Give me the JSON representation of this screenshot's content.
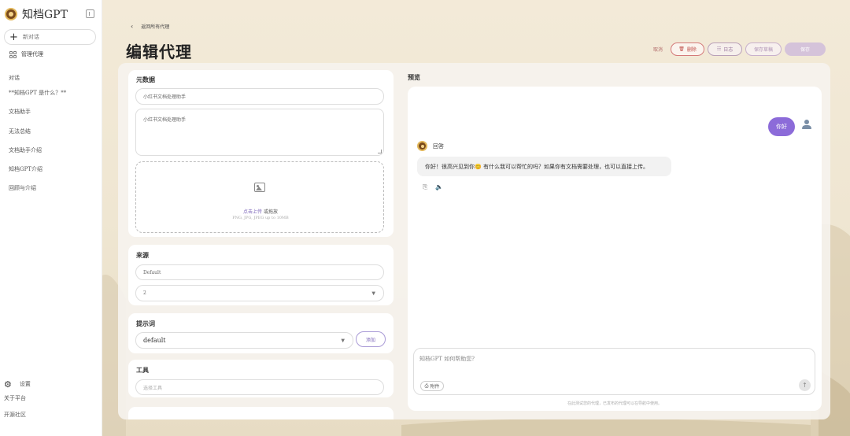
{
  "app": {
    "name": "知档GPT"
  },
  "sidebar": {
    "new_chat": "新对话",
    "manage_agents": "管理代理",
    "section": "对话",
    "conversations": [
      "**知档GPT 是什么？**",
      "文档助手",
      "无法总结",
      "文档助手介绍",
      "知档GPT介绍",
      "回顾与介绍"
    ],
    "settings": "设置",
    "about": "关于平台",
    "community": "开源社区"
  },
  "header": {
    "back_label": "返回所有代理",
    "title": "编辑代理",
    "actions": {
      "cancel": "取消",
      "delete": "删除",
      "logs": "日志",
      "duplicate": "保存草稿",
      "save": "保存"
    }
  },
  "form": {
    "metadata": {
      "title": "元数据",
      "name_value": "小红书文档处理助手",
      "description_value": "小红书文档处理助手",
      "upload_link": "点击上传",
      "upload_or": "或拖放",
      "upload_hint": "PNG, JPG, JPEG up to 10MB"
    },
    "source": {
      "title": "来源",
      "type_value": "Default",
      "select_value": "2"
    },
    "prompt": {
      "title": "提示词",
      "select_value": "default",
      "add_label": "添加"
    },
    "tools": {
      "title": "工具",
      "placeholder": "选择工具"
    }
  },
  "preview": {
    "title": "预览",
    "user_message": "你好",
    "bot_name": "回答",
    "bot_message": "你好！很高兴见到你😊 有什么我可以帮忙的吗？如果你有文档需要处理，也可以直接上传。",
    "input_placeholder": "知档GPT 如何帮助您?",
    "attach_label": "附件",
    "disclaimer": "在此测试您的代理，已发布的代理可以在导航中使用。"
  },
  "colors": {
    "accent": "#8c6bd9",
    "danger": "#c0504a",
    "background": "#f3ead8"
  }
}
